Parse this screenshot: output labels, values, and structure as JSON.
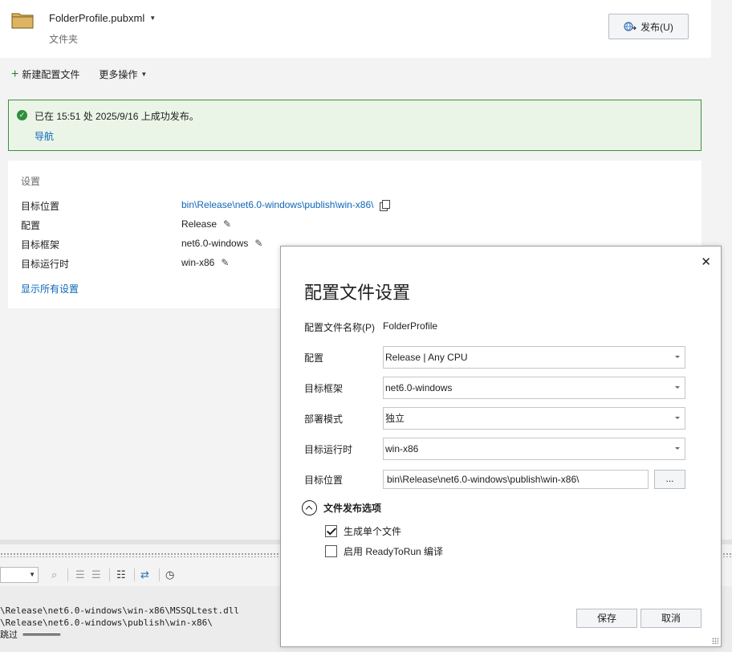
{
  "header": {
    "profile_name": "FolderProfile.pubxml",
    "profile_type": "文件夹",
    "publish_button": "发布(U)"
  },
  "toolbar": {
    "new_profile": "新建配置文件",
    "more_actions": "更多操作"
  },
  "banner": {
    "message": "已在 15:51 处 2025/9/16 上成功发布。",
    "nav_link": "导航"
  },
  "settings": {
    "title": "设置",
    "rows": [
      {
        "label": "目标位置",
        "value": "bin\\Release\\net6.0-windows\\publish\\win-x86\\"
      },
      {
        "label": "配置",
        "value": "Release"
      },
      {
        "label": "目标框架",
        "value": "net6.0-windows"
      },
      {
        "label": "目标运行时",
        "value": "win-x86"
      }
    ],
    "show_all": "显示所有设置"
  },
  "output": {
    "lines": [
      "\\Release\\net6.0-windows\\win-x86\\MSSQLtest.dll",
      "\\Release\\net6.0-windows\\publish\\win-x86\\",
      "跳过 ═══════"
    ]
  },
  "dialog": {
    "title": "配置文件设置",
    "profile_name_label": "配置文件名称(P)",
    "profile_name_value": "FolderProfile",
    "configuration_label": "配置",
    "configuration_value": "Release | Any CPU",
    "framework_label": "目标框架",
    "framework_value": "net6.0-windows",
    "deploy_mode_label": "部署模式",
    "deploy_mode_value": "独立",
    "runtime_label": "目标运行时",
    "runtime_value": "win-x86",
    "location_label": "目标位置",
    "location_value": "bin\\Release\\net6.0-windows\\publish\\win-x86\\",
    "browse_label": "...",
    "file_options_label": "文件发布选项",
    "single_file_label": "生成单个文件",
    "single_file_checked": true,
    "readytorun_label": "启用 ReadyToRun 编译",
    "readytorun_checked": false,
    "save_button": "保存",
    "cancel_button": "取消"
  },
  "colors": {
    "accent_link": "#0e66b8",
    "success_border": "#3f8f3f",
    "success_bg": "#eaf5e8"
  }
}
